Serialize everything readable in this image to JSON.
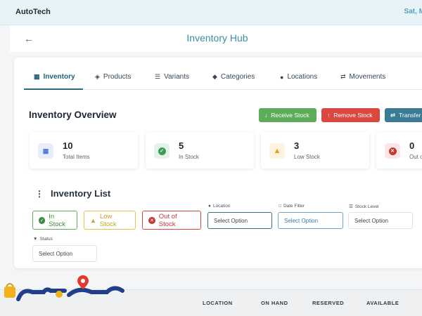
{
  "app": {
    "title": "AutoTech",
    "date_fragment": "Sat, M"
  },
  "header": {
    "back_icon": "arrow-left-icon",
    "title": "Inventory Hub"
  },
  "tabs": [
    {
      "label": "Inventory",
      "icon": "boxes-icon",
      "active": true
    },
    {
      "label": "Products",
      "icon": "products-icon",
      "active": false
    },
    {
      "label": "Variants",
      "icon": "layers-icon",
      "active": false
    },
    {
      "label": "Categories",
      "icon": "tags-icon",
      "active": false
    },
    {
      "label": "Locations",
      "icon": "map-pin-icon",
      "active": false
    },
    {
      "label": "Movements",
      "icon": "exchange-icon",
      "active": false
    }
  ],
  "overview": {
    "title": "Inventory Overview",
    "actions": {
      "receive": "Receive Stock",
      "remove": "Remove Stock",
      "transfer": "Transfer"
    }
  },
  "stats": [
    {
      "value": "10",
      "label": "Total Items",
      "icon": "boxes-icon",
      "color": "#4a78d6"
    },
    {
      "value": "5",
      "label": "In Stock",
      "icon": "check-circle-icon",
      "color": "#3f9a5a"
    },
    {
      "value": "3",
      "label": "Low Stock",
      "icon": "warning-icon",
      "color": "#e0a21a"
    },
    {
      "value": "0",
      "label": "Out of Stock",
      "label_visible": "Out o",
      "icon": "x-circle-icon",
      "color": "#c23a33"
    }
  ],
  "inventory_list": {
    "title": "Inventory List",
    "chips": {
      "in_stock": "In Stock",
      "low_stock": "Low Stock",
      "out_of_stock": "Out of Stock"
    },
    "filters": {
      "location": {
        "label": "Location",
        "value": "Select Option"
      },
      "date": {
        "label": "Date Filter",
        "value": "Select Option"
      },
      "level": {
        "label": "Stock Level",
        "value": "Select Option"
      },
      "status": {
        "label": "Status",
        "value": "Select Option"
      }
    }
  },
  "table": {
    "columns": [
      "LOCATION",
      "ON HAND",
      "RESERVED",
      "AVAILABLE"
    ]
  },
  "colors": {
    "accent": "#2b6b80",
    "receive": "#5fad5b",
    "remove": "#d9473f",
    "transfer": "#3a7a95"
  }
}
